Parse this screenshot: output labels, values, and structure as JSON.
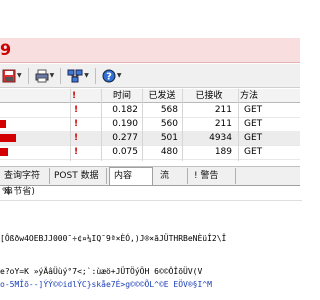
{
  "title_fragment": "9",
  "toolbar": {
    "icons": [
      "save-icon",
      "print-icon",
      "network-icon",
      "help-icon"
    ]
  },
  "grid": {
    "headers": [
      "!",
      "时间",
      "已发送",
      "已接收",
      "方法"
    ],
    "rows": [
      {
        "flag": "!",
        "time": "0.182",
        "sent": "568",
        "recv": "211",
        "method": "GET"
      },
      {
        "flag": "!",
        "time": "0.190",
        "sent": "560",
        "recv": "211",
        "method": "GET"
      },
      {
        "flag": "!",
        "time": "0.277",
        "sent": "501",
        "recv": "4934",
        "method": "GET"
      },
      {
        "flag": "!",
        "time": "0.075",
        "sent": "480",
        "recv": "189",
        "method": "GET"
      }
    ]
  },
  "tabs": [
    "查询字符串",
    "POST 数据",
    "内容",
    "流",
    "! 警告"
  ],
  "pct_line": "% 节省)",
  "garbled": [
    "[Ôßðw4OEBJJ000¯÷¢¤¼IQ¯9ª×ÈÓ,)J®×ãJÜTHRBeNÈüÎ2\\Î",
    "e?oY=K      »ýÄâÜùý°7<;`:ùæö+JÜTÖýÖH    6©©ÔÎõÜV(V",
    "o-5MÎõ--]ÝÝ©©idlÝC}skåe7É>g©©©ÕL^©E EÖV®§I^M"
  ],
  "colors": {
    "warning_red": "#d00000",
    "bar_red": "#d40000",
    "title_red": "#cc0000"
  }
}
